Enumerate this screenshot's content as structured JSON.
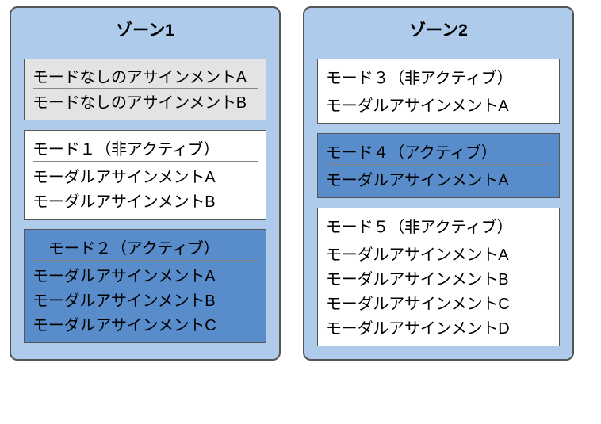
{
  "zones": [
    {
      "title": "ゾーン1",
      "blocks": [
        {
          "type": "modeless",
          "assignments": [
            "モードなしのアサインメントA",
            "モードなしのアサインメントB"
          ]
        },
        {
          "type": "inactive",
          "header": "モード１（非アクティブ）",
          "assignments": [
            "モーダルアサインメントA",
            "モーダルアサインメントB"
          ]
        },
        {
          "type": "active",
          "header": "　モード２（アクティブ）",
          "assignments": [
            "モーダルアサインメントA",
            "モーダルアサインメントB",
            "モーダルアサインメントC"
          ]
        }
      ]
    },
    {
      "title": "ゾーン2",
      "blocks": [
        {
          "type": "inactive",
          "header": "モード３（非アクティブ）",
          "assignments": [
            "モーダルアサインメントA"
          ]
        },
        {
          "type": "active",
          "header": "モード４（アクティブ）",
          "assignments": [
            "モーダルアサインメントA"
          ]
        },
        {
          "type": "inactive",
          "header": "モード５（非アクティブ）",
          "assignments": [
            "モーダルアサインメントA",
            "モーダルアサインメントB",
            "モーダルアサインメントC",
            "モーダルアサインメントD"
          ]
        }
      ]
    }
  ]
}
